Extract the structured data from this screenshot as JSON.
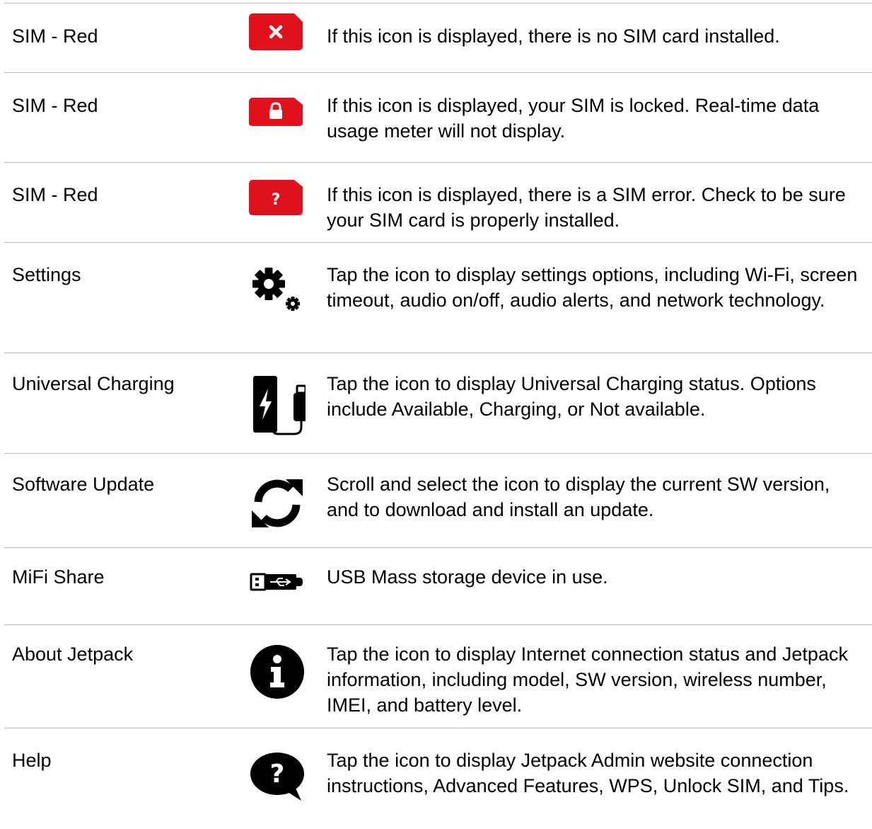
{
  "colors": {
    "sim_red": "#e0111d",
    "divider": "#bdbdbd",
    "icon_black": "#000000",
    "text": "#000000"
  },
  "rows": [
    {
      "name": "SIM - Red",
      "icon": "sim-missing-icon",
      "description": "If this icon is displayed, there is no SIM card installed."
    },
    {
      "name": "SIM - Red",
      "icon": "sim-locked-icon",
      "description": "If this icon is displayed, your SIM is locked. Real-time data usage meter will not display."
    },
    {
      "name": "SIM - Red",
      "icon": "sim-error-icon",
      "description": "If this icon is displayed, there is a SIM error. Check to be sure your SIM card is properly installed."
    },
    {
      "name": "Settings",
      "icon": "gear-icon",
      "description": "Tap the icon to display settings options, including Wi-Fi, screen timeout, audio on/off, audio alerts, and network technology."
    },
    {
      "name": "Universal Charging",
      "icon": "universal-charging-icon",
      "description": "Tap the icon to display Universal Charging status. Options include Available, Charging, or Not available."
    },
    {
      "name": "Software Update",
      "icon": "refresh-icon",
      "description": "Scroll and select the icon to display the current SW version, and to download and install an update."
    },
    {
      "name": "MiFi Share",
      "icon": "usb-drive-icon",
      "description": "USB Mass storage device in use."
    },
    {
      "name": "About Jetpack",
      "icon": "info-icon",
      "description": "Tap the icon to display Internet connection status and Jetpack information, including model, SW version, wireless number, IMEI, and battery level."
    },
    {
      "name": "Help",
      "icon": "help-icon",
      "description": "Tap the icon to display Jetpack Admin website connection instructions, Advanced Features, WPS, Unlock SIM, and Tips."
    }
  ]
}
